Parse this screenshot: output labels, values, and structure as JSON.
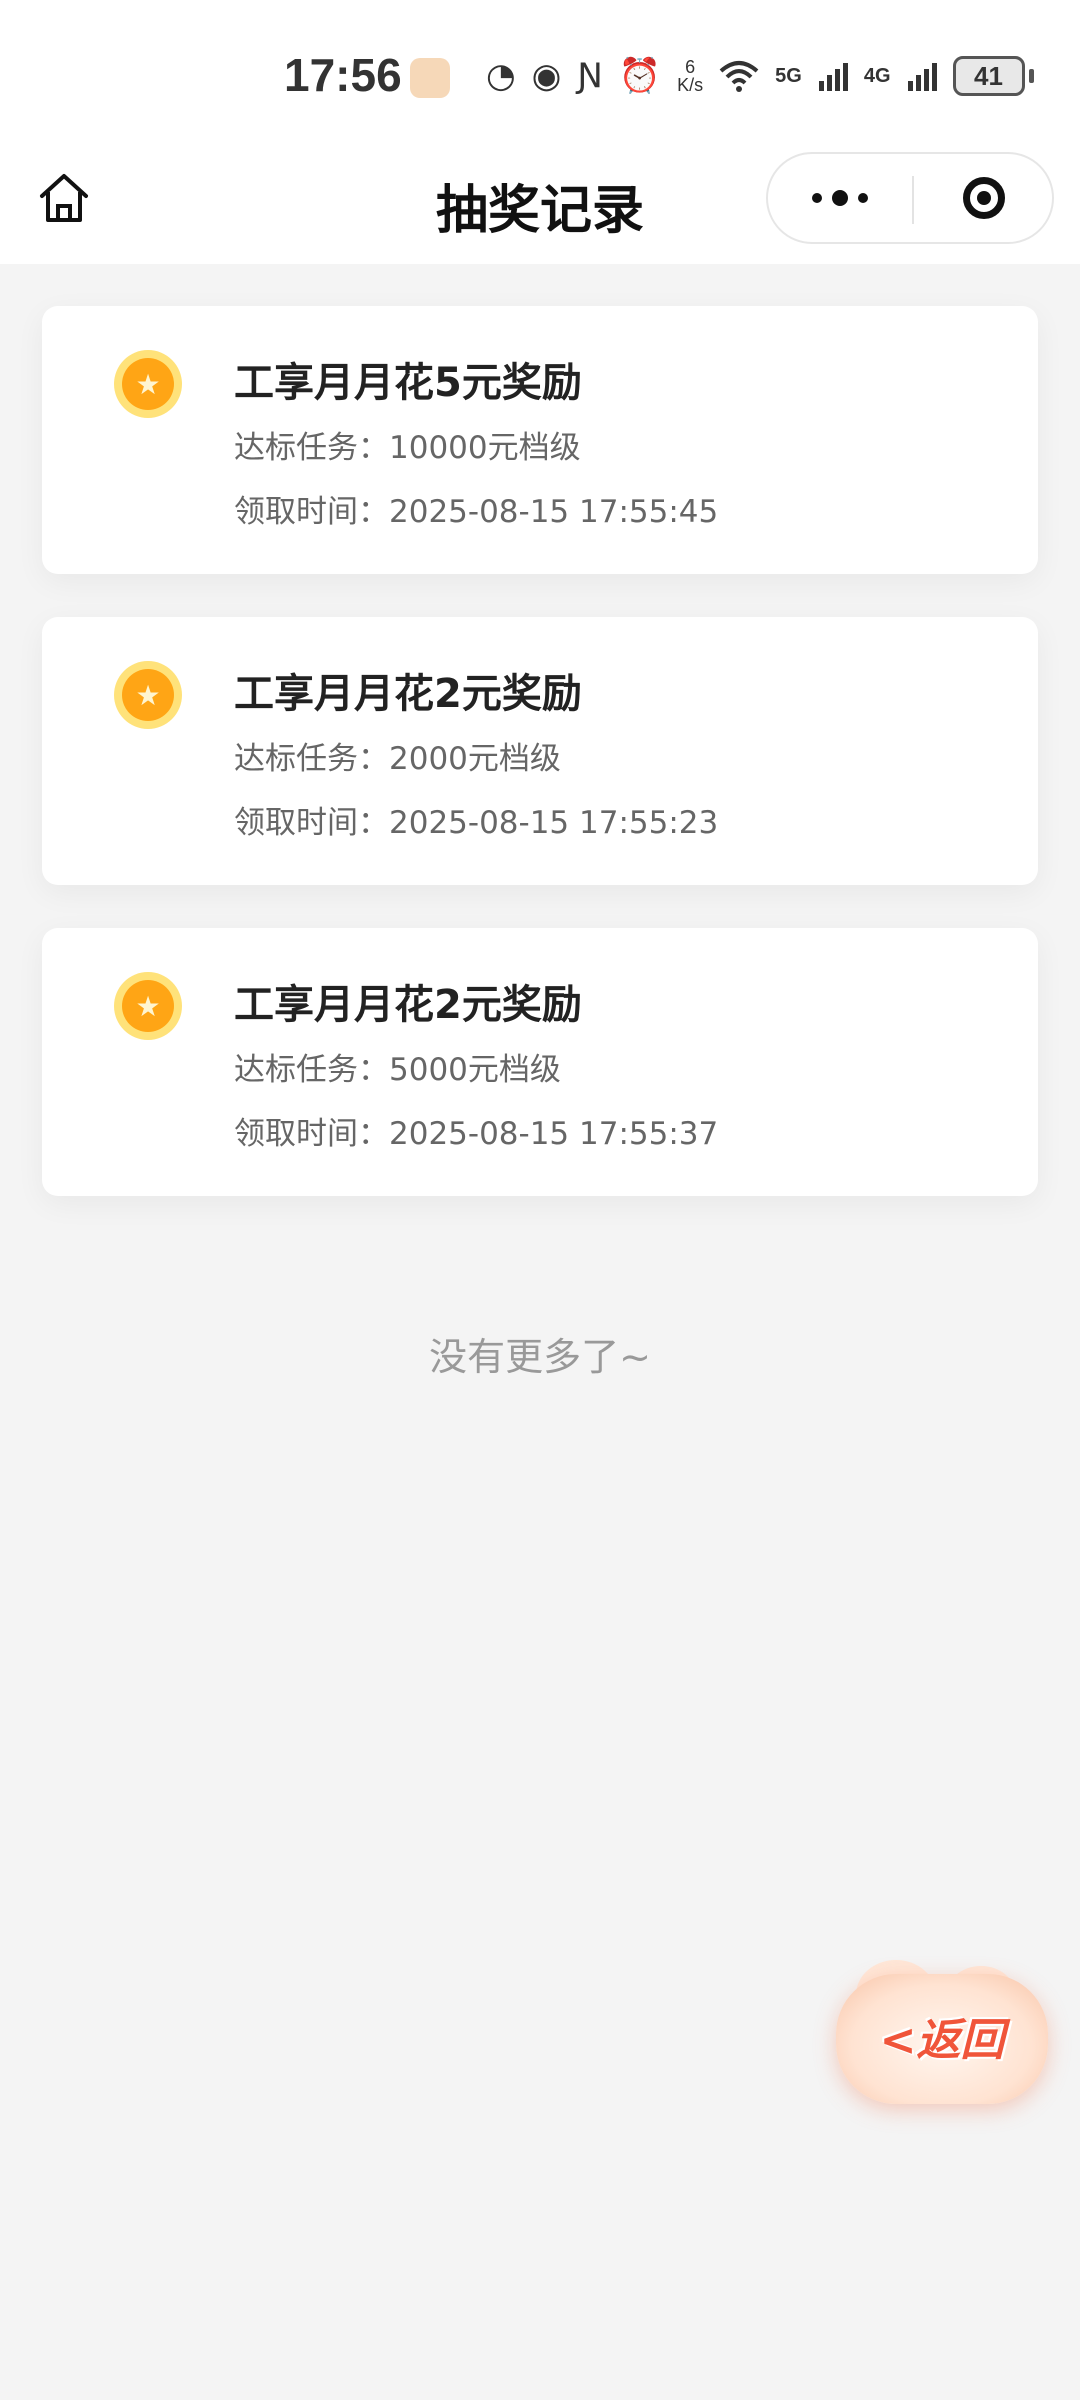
{
  "status_bar": {
    "time": "17:56",
    "speed_value": "6",
    "speed_unit": "K/s",
    "net1": "5G",
    "net2": "4G",
    "battery": "41"
  },
  "header": {
    "title": "抽奖记录"
  },
  "records": [
    {
      "title": "工享月月花5元奖励",
      "task_label": "达标任务：",
      "task_value": "10000元档级",
      "time_label": "领取时间：",
      "time_value": "2025-08-15 17:55:45"
    },
    {
      "title": "工享月月花2元奖励",
      "task_label": "达标任务：",
      "task_value": "2000元档级",
      "time_label": "领取时间：",
      "time_value": "2025-08-15 17:55:23"
    },
    {
      "title": "工享月月花2元奖励",
      "task_label": "达标任务：",
      "task_value": "5000元档级",
      "time_label": "领取时间：",
      "time_value": "2025-08-15 17:55:37"
    }
  ],
  "footer": {
    "no_more": "没有更多了~"
  },
  "float_button": {
    "label": "<返回"
  },
  "icons": {
    "coin": "star-coin-icon",
    "home": "home-icon",
    "more": "more-dots-icon",
    "close": "target-close-icon"
  },
  "colors": {
    "coin_outer": "#ffe27a",
    "coin_inner": "#ffa515",
    "back_text": "#f0553a",
    "background": "#f4f4f4"
  }
}
